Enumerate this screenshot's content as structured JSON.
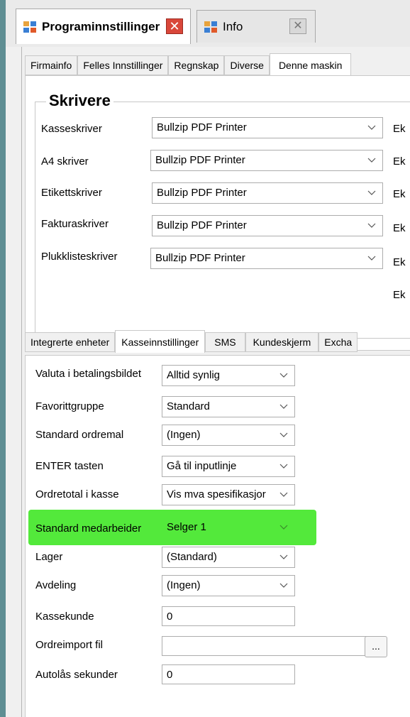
{
  "doc_tabs": [
    {
      "title": "Programinnstillinger",
      "close": "✕"
    },
    {
      "title": "Info",
      "close": "✕"
    }
  ],
  "top_tabs": [
    "Firmainfo",
    "Felles Innstillinger",
    "Regnskap",
    "Diverse",
    "Denne maskin"
  ],
  "printers": {
    "title": "Skrivere",
    "rows": [
      {
        "label": "Kasseskriver",
        "value": "Bullzip PDF Printer",
        "extra": "Ek"
      },
      {
        "label": "A4 skriver",
        "value": "Bullzip PDF Printer",
        "extra": "Ek"
      },
      {
        "label": "Etikettskriver",
        "value": "Bullzip PDF Printer",
        "extra": "Ek"
      },
      {
        "label": "Fakturaskriver",
        "value": "Bullzip PDF Printer",
        "extra": "Ek"
      },
      {
        "label": "Plukklisteskriver",
        "value": "Bullzip PDF Printer",
        "extra": "Ek"
      }
    ],
    "extra_last": "Ek"
  },
  "bottom_tabs": [
    "Integrerte enheter",
    "Kasseinnstillinger",
    "SMS",
    "Kundeskjerm",
    "Excha"
  ],
  "kasse": {
    "rows": [
      {
        "label": "Valuta i betalingsbildet",
        "value": "Alltid synlig"
      },
      {
        "label": "Favorittgruppe",
        "value": "Standard"
      },
      {
        "label": "Standard ordremal",
        "value": "(Ingen)"
      },
      {
        "label": "ENTER tasten",
        "value": "Gå til inputlinje"
      },
      {
        "label": "Ordretotal i kasse",
        "value": "Vis mva spesifikasjor"
      },
      {
        "label": "Standard medarbeider",
        "value": "Selger 1"
      },
      {
        "label": "Lager",
        "value": "(Standard)"
      },
      {
        "label": "Avdeling",
        "value": "(Ingen)"
      }
    ],
    "kassekunde": {
      "label": "Kassekunde",
      "value": "0"
    },
    "ordreimport": {
      "label": "Ordreimport fil",
      "value": "",
      "button": "..."
    },
    "autolas": {
      "label": "Autolås sekunder",
      "value": "0"
    }
  },
  "colors": {
    "highlight": "#53e93b",
    "close_red": "#d9473a",
    "side_strip": "#5f8e93"
  }
}
